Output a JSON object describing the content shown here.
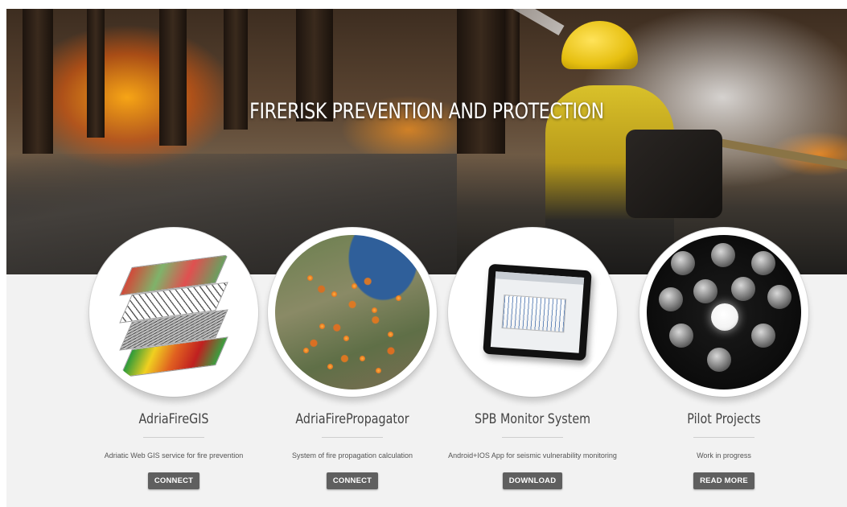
{
  "hero": {
    "title": "FIRERISK PREVENTION AND PROTECTION"
  },
  "cards": [
    {
      "title": "AdriaFireGIS",
      "description": "Adriatic Web GIS service for fire prevention",
      "button": "CONNECT",
      "image_icon": "gis-layers-image"
    },
    {
      "title": "AdriaFirePropagator",
      "description": "System of fire propagation calculation",
      "button": "CONNECT",
      "image_icon": "fire-map-image"
    },
    {
      "title": "SPB Monitor System",
      "description": "Android+IOS App for seismic vulnerability monitoring",
      "button": "DOWNLOAD",
      "image_icon": "tablet-image"
    },
    {
      "title": "Pilot Projects",
      "description": "Work in progress",
      "button": "READ MORE",
      "image_icon": "light-bulbs-image"
    }
  ],
  "colors": {
    "button_bg": "#5f5f5f",
    "section_bg": "#f2f2f2",
    "title_text": "#444444"
  }
}
